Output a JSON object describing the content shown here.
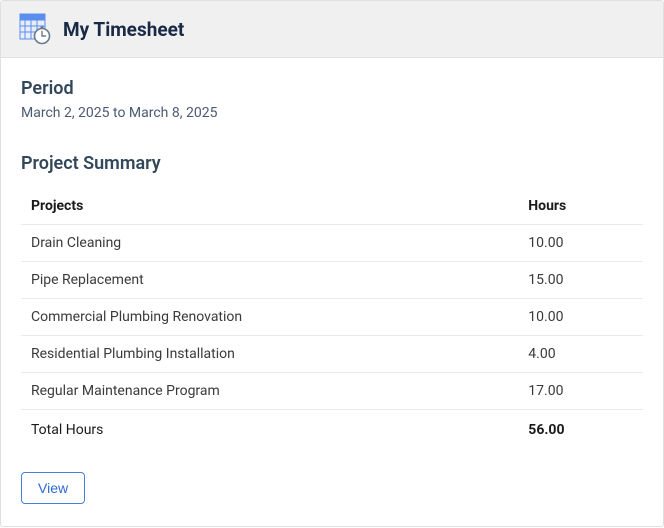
{
  "header": {
    "title": "My Timesheet"
  },
  "period": {
    "label": "Period",
    "value": "March 2, 2025 to March 8, 2025"
  },
  "summary": {
    "label": "Project Summary",
    "columns": {
      "projects": "Projects",
      "hours": "Hours"
    },
    "rows": [
      {
        "project": "Drain Cleaning",
        "hours": "10.00"
      },
      {
        "project": "Pipe Replacement",
        "hours": "15.00"
      },
      {
        "project": "Commercial Plumbing Renovation",
        "hours": "10.00"
      },
      {
        "project": "Residential Plumbing Installation",
        "hours": "4.00"
      },
      {
        "project": "Regular Maintenance Program",
        "hours": "17.00"
      }
    ],
    "total": {
      "label": "Total Hours",
      "hours": "56.00"
    }
  },
  "actions": {
    "view_label": "View"
  },
  "colors": {
    "calendar_blue": "#5b8def",
    "stopwatch_ring": "#6a7a8a"
  }
}
